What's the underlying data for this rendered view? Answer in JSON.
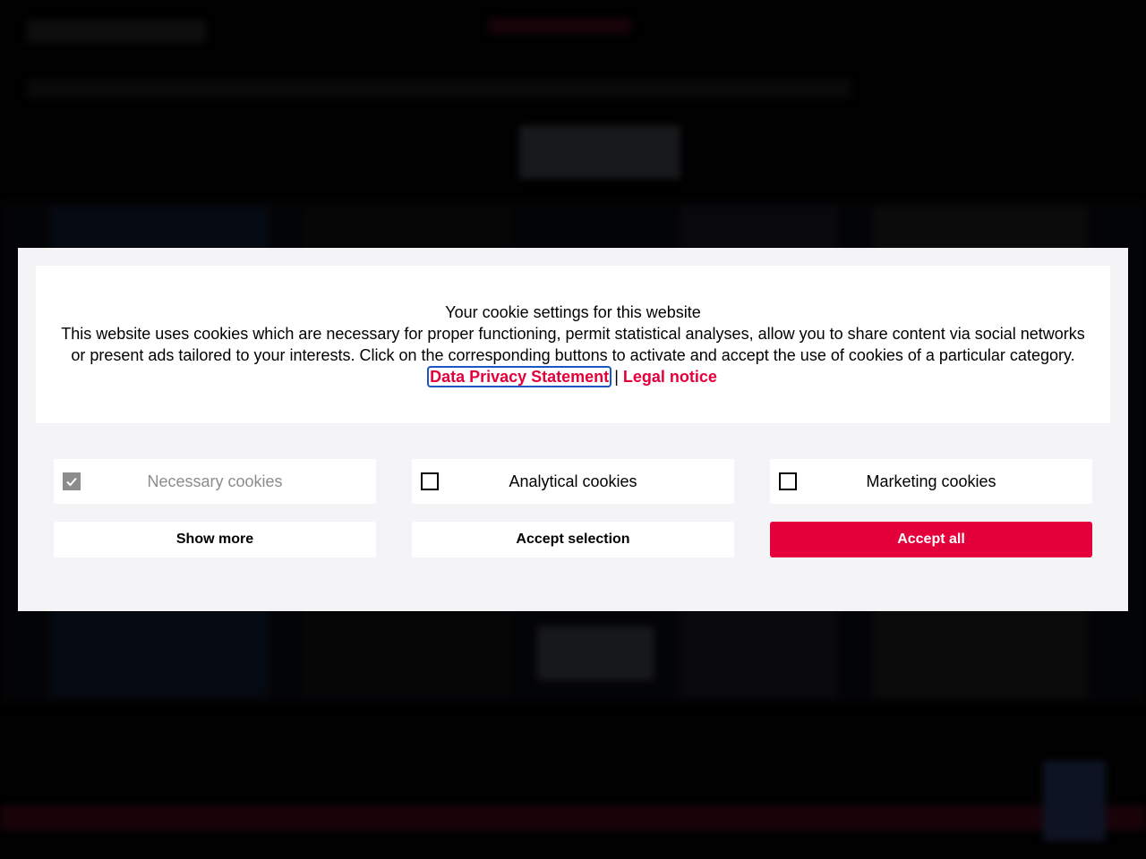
{
  "cookie_banner": {
    "title": "Your cookie settings for this website",
    "description": "This website uses cookies which are necessary for proper functioning, permit statistical analyses, allow you to share content via social networks or present ads tailored to your interests. Click on the corresponding buttons to activate and accept the use of cookies of a particular category.",
    "privacy_link": "Data Privacy Statement",
    "separator": "|",
    "legal_link": "Legal notice",
    "categories": [
      {
        "label": "Necessary cookies",
        "checked": true,
        "disabled": true
      },
      {
        "label": "Analytical cookies",
        "checked": false,
        "disabled": false
      },
      {
        "label": "Marketing cookies",
        "checked": false,
        "disabled": false
      }
    ],
    "buttons": {
      "show_more": "Show more",
      "accept_selection": "Accept selection",
      "accept_all": "Accept all"
    },
    "colors": {
      "accent": "#e4003a",
      "panel_bg": "#f4f4f6",
      "focus_outline": "#1b56c4",
      "disabled": "#8c8c8c"
    }
  }
}
